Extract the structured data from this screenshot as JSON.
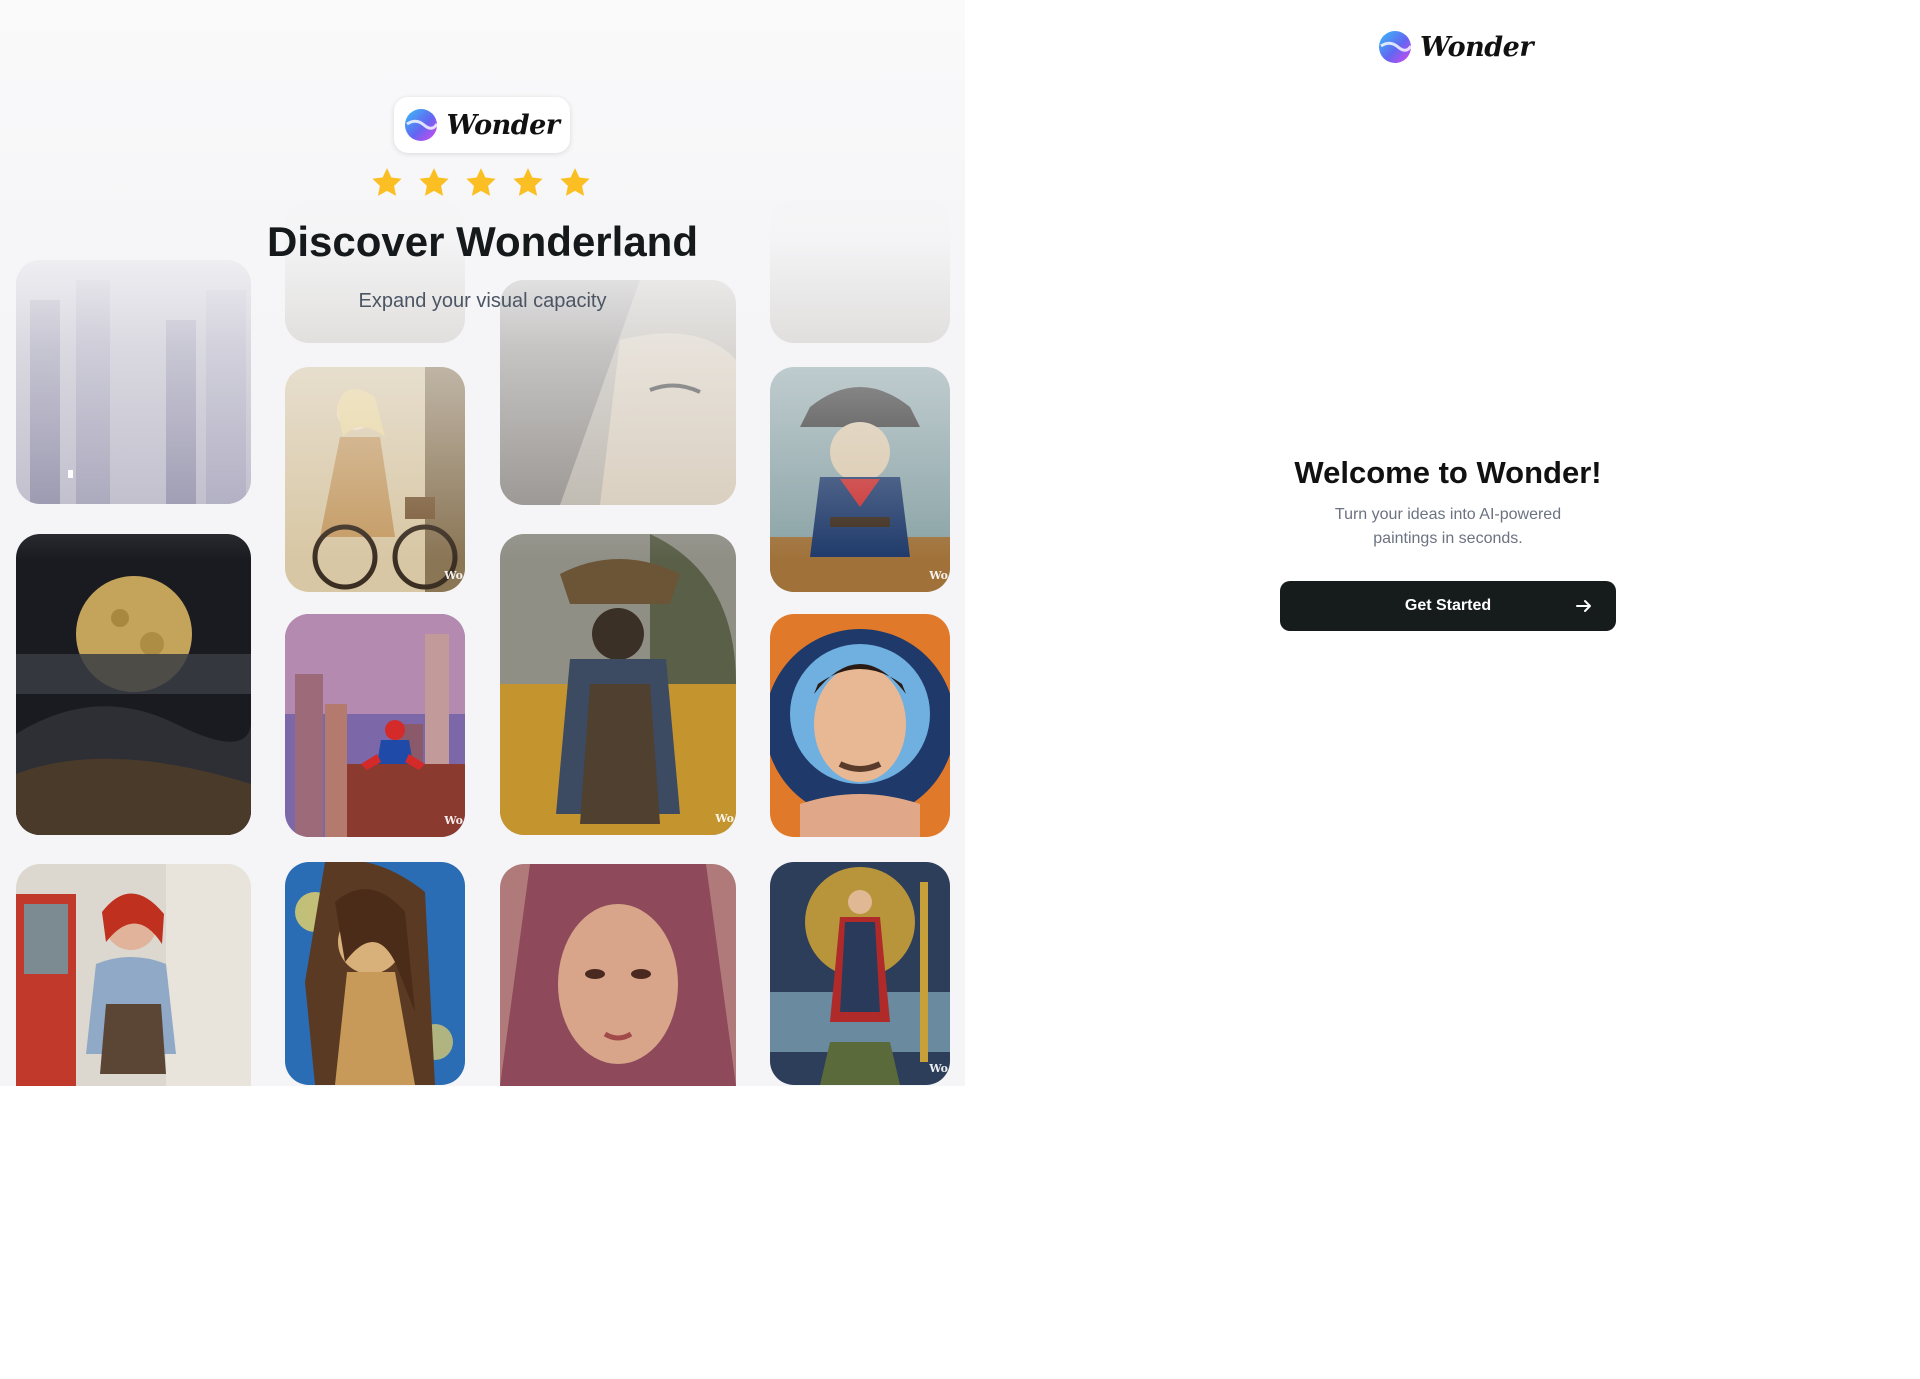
{
  "brand": {
    "name": "Wonder"
  },
  "hero": {
    "rating_stars": 5,
    "star_color": "#fbbf24",
    "title": "Discover Wonderland",
    "subtitle": "Expand your visual capacity"
  },
  "gallery": {
    "watermark": "Wo",
    "images": [
      {
        "name": "foggy-city"
      },
      {
        "name": "moon-landscape"
      },
      {
        "name": "redhead-woman-van"
      },
      {
        "name": "woman-on-bicycle"
      },
      {
        "name": "spiderman-city"
      },
      {
        "name": "woman-starry-night"
      },
      {
        "name": "mosaic-face"
      },
      {
        "name": "scarecrow-field"
      },
      {
        "name": "woman-portrait"
      },
      {
        "name": "pirate-otter"
      },
      {
        "name": "man-portrait-glow"
      },
      {
        "name": "tarot-card-figure"
      }
    ]
  },
  "welcome": {
    "title": "Welcome to Wonder!",
    "description": "Turn your ideas into AI-powered paintings in seconds.",
    "cta_label": "Get Started",
    "cta_icon": "arrow-right-icon",
    "cta_color": "#151c1b"
  }
}
